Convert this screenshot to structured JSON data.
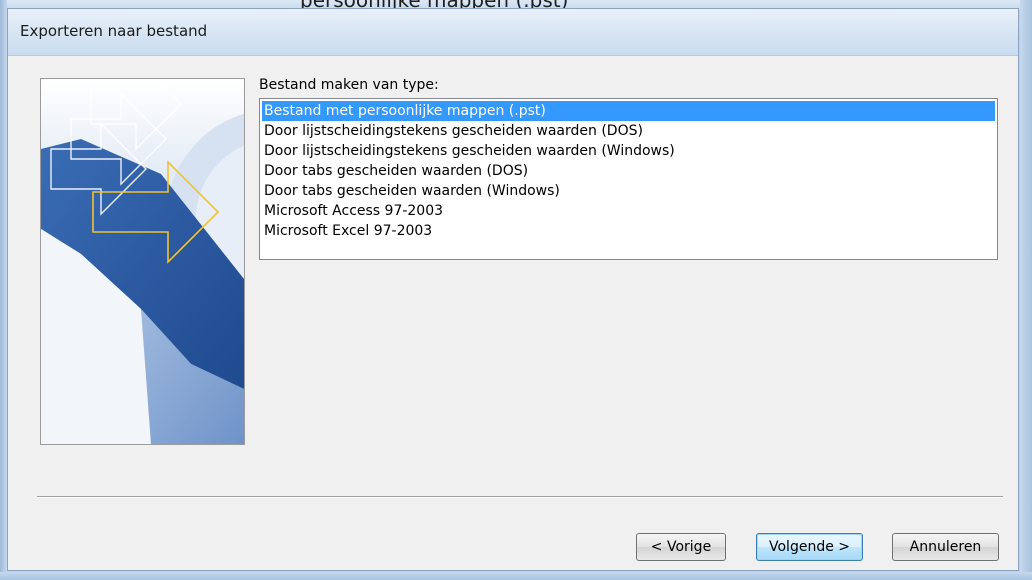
{
  "background": {
    "window_title_fragment": "persoonlijke mappen (.pst)"
  },
  "dialog": {
    "title": "Exporteren naar bestand",
    "prompt": "Bestand maken van type:",
    "file_types": [
      "Bestand met persoonlijke mappen (.pst)",
      "Door lijstscheidingstekens gescheiden waarden (DOS)",
      "Door lijstscheidingstekens gescheiden waarden (Windows)",
      "Door tabs gescheiden waarden (DOS)",
      "Door tabs gescheiden waarden (Windows)",
      "Microsoft Access 97-2003",
      "Microsoft Excel 97-2003"
    ],
    "selected_index": 0,
    "buttons": {
      "prev": "< Vorige",
      "next": "Volgende >",
      "cancel": "Annuleren"
    }
  },
  "colors": {
    "selection": "#3399ff",
    "art_blue": "#2f5fa8",
    "art_arrow": "#f2c230"
  }
}
